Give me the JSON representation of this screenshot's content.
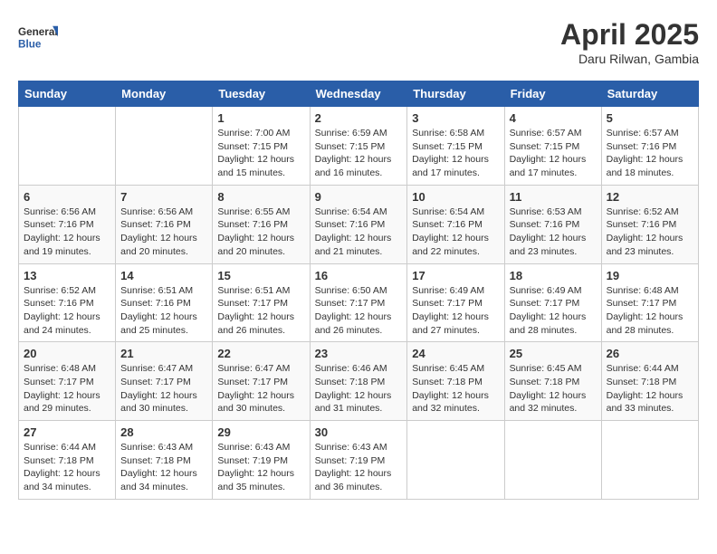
{
  "header": {
    "logo_general": "General",
    "logo_blue": "Blue",
    "title": "April 2025",
    "subtitle": "Daru Rilwan, Gambia"
  },
  "days_of_week": [
    "Sunday",
    "Monday",
    "Tuesday",
    "Wednesday",
    "Thursday",
    "Friday",
    "Saturday"
  ],
  "weeks": [
    [
      {
        "day": "",
        "info": ""
      },
      {
        "day": "",
        "info": ""
      },
      {
        "day": "1",
        "info": "Sunrise: 7:00 AM\nSunset: 7:15 PM\nDaylight: 12 hours and 15 minutes."
      },
      {
        "day": "2",
        "info": "Sunrise: 6:59 AM\nSunset: 7:15 PM\nDaylight: 12 hours and 16 minutes."
      },
      {
        "day": "3",
        "info": "Sunrise: 6:58 AM\nSunset: 7:15 PM\nDaylight: 12 hours and 17 minutes."
      },
      {
        "day": "4",
        "info": "Sunrise: 6:57 AM\nSunset: 7:15 PM\nDaylight: 12 hours and 17 minutes."
      },
      {
        "day": "5",
        "info": "Sunrise: 6:57 AM\nSunset: 7:16 PM\nDaylight: 12 hours and 18 minutes."
      }
    ],
    [
      {
        "day": "6",
        "info": "Sunrise: 6:56 AM\nSunset: 7:16 PM\nDaylight: 12 hours and 19 minutes."
      },
      {
        "day": "7",
        "info": "Sunrise: 6:56 AM\nSunset: 7:16 PM\nDaylight: 12 hours and 20 minutes."
      },
      {
        "day": "8",
        "info": "Sunrise: 6:55 AM\nSunset: 7:16 PM\nDaylight: 12 hours and 20 minutes."
      },
      {
        "day": "9",
        "info": "Sunrise: 6:54 AM\nSunset: 7:16 PM\nDaylight: 12 hours and 21 minutes."
      },
      {
        "day": "10",
        "info": "Sunrise: 6:54 AM\nSunset: 7:16 PM\nDaylight: 12 hours and 22 minutes."
      },
      {
        "day": "11",
        "info": "Sunrise: 6:53 AM\nSunset: 7:16 PM\nDaylight: 12 hours and 23 minutes."
      },
      {
        "day": "12",
        "info": "Sunrise: 6:52 AM\nSunset: 7:16 PM\nDaylight: 12 hours and 23 minutes."
      }
    ],
    [
      {
        "day": "13",
        "info": "Sunrise: 6:52 AM\nSunset: 7:16 PM\nDaylight: 12 hours and 24 minutes."
      },
      {
        "day": "14",
        "info": "Sunrise: 6:51 AM\nSunset: 7:16 PM\nDaylight: 12 hours and 25 minutes."
      },
      {
        "day": "15",
        "info": "Sunrise: 6:51 AM\nSunset: 7:17 PM\nDaylight: 12 hours and 26 minutes."
      },
      {
        "day": "16",
        "info": "Sunrise: 6:50 AM\nSunset: 7:17 PM\nDaylight: 12 hours and 26 minutes."
      },
      {
        "day": "17",
        "info": "Sunrise: 6:49 AM\nSunset: 7:17 PM\nDaylight: 12 hours and 27 minutes."
      },
      {
        "day": "18",
        "info": "Sunrise: 6:49 AM\nSunset: 7:17 PM\nDaylight: 12 hours and 28 minutes."
      },
      {
        "day": "19",
        "info": "Sunrise: 6:48 AM\nSunset: 7:17 PM\nDaylight: 12 hours and 28 minutes."
      }
    ],
    [
      {
        "day": "20",
        "info": "Sunrise: 6:48 AM\nSunset: 7:17 PM\nDaylight: 12 hours and 29 minutes."
      },
      {
        "day": "21",
        "info": "Sunrise: 6:47 AM\nSunset: 7:17 PM\nDaylight: 12 hours and 30 minutes."
      },
      {
        "day": "22",
        "info": "Sunrise: 6:47 AM\nSunset: 7:17 PM\nDaylight: 12 hours and 30 minutes."
      },
      {
        "day": "23",
        "info": "Sunrise: 6:46 AM\nSunset: 7:18 PM\nDaylight: 12 hours and 31 minutes."
      },
      {
        "day": "24",
        "info": "Sunrise: 6:45 AM\nSunset: 7:18 PM\nDaylight: 12 hours and 32 minutes."
      },
      {
        "day": "25",
        "info": "Sunrise: 6:45 AM\nSunset: 7:18 PM\nDaylight: 12 hours and 32 minutes."
      },
      {
        "day": "26",
        "info": "Sunrise: 6:44 AM\nSunset: 7:18 PM\nDaylight: 12 hours and 33 minutes."
      }
    ],
    [
      {
        "day": "27",
        "info": "Sunrise: 6:44 AM\nSunset: 7:18 PM\nDaylight: 12 hours and 34 minutes."
      },
      {
        "day": "28",
        "info": "Sunrise: 6:43 AM\nSunset: 7:18 PM\nDaylight: 12 hours and 34 minutes."
      },
      {
        "day": "29",
        "info": "Sunrise: 6:43 AM\nSunset: 7:19 PM\nDaylight: 12 hours and 35 minutes."
      },
      {
        "day": "30",
        "info": "Sunrise: 6:43 AM\nSunset: 7:19 PM\nDaylight: 12 hours and 36 minutes."
      },
      {
        "day": "",
        "info": ""
      },
      {
        "day": "",
        "info": ""
      },
      {
        "day": "",
        "info": ""
      }
    ]
  ]
}
